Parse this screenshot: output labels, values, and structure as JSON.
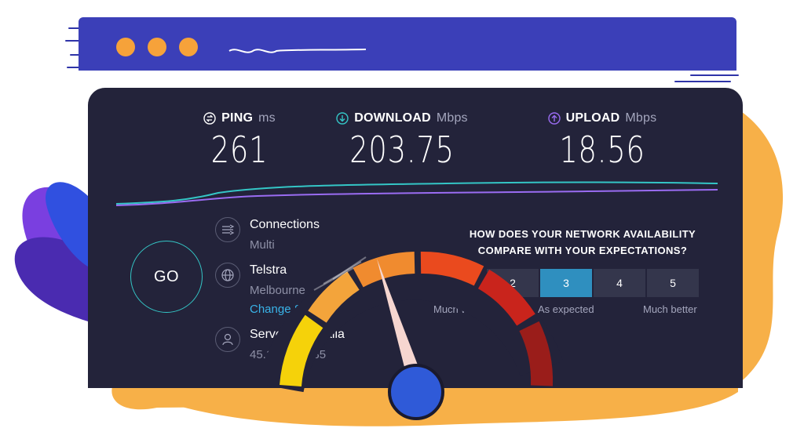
{
  "metrics": {
    "ping": {
      "name": "PING",
      "unit": "ms",
      "value": "261",
      "icon": "ping-icon"
    },
    "download": {
      "name": "DOWNLOAD",
      "unit": "Mbps",
      "value": "203.75",
      "icon": "download-arrow-icon"
    },
    "upload": {
      "name": "UPLOAD",
      "unit": "Mbps",
      "value": "18.56",
      "icon": "upload-arrow-icon"
    }
  },
  "go_label": "GO",
  "connections": {
    "title": "Connections",
    "value": "Multi",
    "icon": "connections-icon"
  },
  "provider": {
    "title": "Telstra",
    "location": "Melbourne",
    "change_link": "Change Ser",
    "icon": "globe-icon"
  },
  "server": {
    "title": "Servers Australia",
    "ip": "45.132",
    "ip_tail": "5.85",
    "icon": "user-icon"
  },
  "survey": {
    "question_line1": "HOW DOES YOUR NETWORK AVAILABILITY",
    "question_line2": "COMPARE WITH YOUR EXPECTATIONS?",
    "options": [
      "2",
      "3",
      "4",
      "5"
    ],
    "selected": "3",
    "label_low": "Much wo",
    "label_mid": "As expected",
    "label_high": "Much better"
  },
  "colors": {
    "title_bar": "#3b3fb8",
    "panel": "#23233a",
    "accent_teal": "#34c6c6",
    "accent_purple": "#9a6cf2",
    "link": "#39b3e8",
    "selected": "#2f8fbf",
    "blob_orange": "#f7b048"
  }
}
